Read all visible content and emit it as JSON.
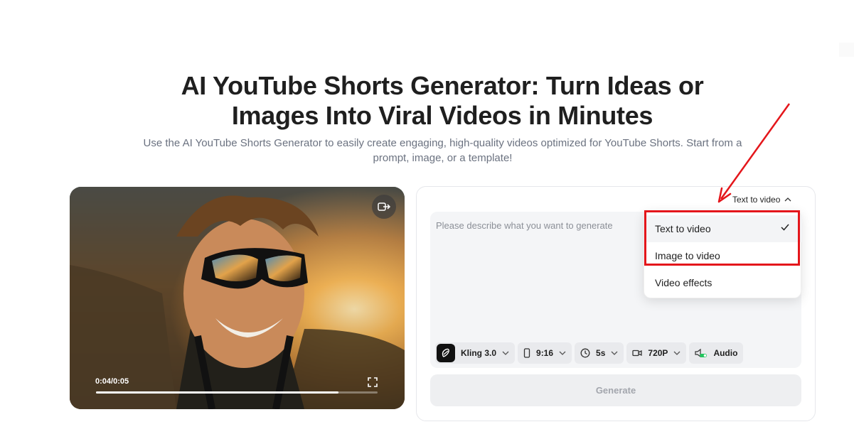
{
  "hero": {
    "title_line1": "AI YouTube Shorts Generator: Turn Ideas or",
    "title_line2": "Images Into Viral Videos in Minutes",
    "subtitle": "Use the AI YouTube Shorts Generator to easily create engaging, high-quality videos optimized for YouTube Shorts. Start from a prompt, image, or a template!"
  },
  "video": {
    "time": "0:04/0:05",
    "progress": 0.86,
    "toggle_icon": "swap-icon",
    "fullscreen_icon": "fullscreen-icon"
  },
  "generator": {
    "mode_label": "Text to video",
    "prompt_placeholder": "Please describe what you want to generate",
    "model": "Kling 3.0",
    "aspect": "9:16",
    "duration": "5s",
    "resolution": "720P",
    "audio": "Audio",
    "generate_label": "Generate"
  },
  "menu": {
    "items": [
      {
        "label": "Text to video",
        "selected": true
      },
      {
        "label": "Image to video",
        "selected": false
      },
      {
        "label": "Video effects",
        "selected": false
      }
    ]
  },
  "colors": {
    "highlight": "#e4161b",
    "audio_toggle": "#22c55e"
  }
}
